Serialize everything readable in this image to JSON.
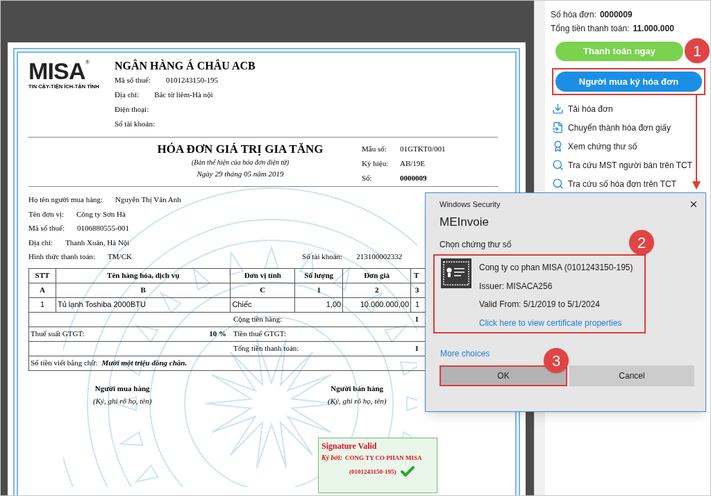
{
  "invoice": {
    "logo": {
      "wordmark": "MISA",
      "registered": "®",
      "tagline": "TIN CẬY-TIỆN ÍCH-TẬN TÌNH"
    },
    "seller": {
      "name": "NGÂN HÀNG Á CHÂU ACB",
      "fields": [
        {
          "label": "Mã số thuế:",
          "value": "0101243150-195"
        },
        {
          "label": "Địa chỉ:",
          "value": "Bắc từ liêm-Hà nội"
        },
        {
          "label": "Điện thoại:"
        },
        {
          "label": "Số tài khoản:"
        }
      ]
    },
    "title": "HÓA ĐƠN GIÁ TRỊ GIA TĂNG",
    "subtitle": "(Bản thể hiện của hóa đơn điện tử)",
    "date": "Ngày 29 tháng 05 năm 2019",
    "meta": [
      {
        "label": "Mẫu số:",
        "value": "01GTKT0/001",
        "bold": false
      },
      {
        "label": "Ký hiệu:",
        "value": "AB/19E",
        "bold": false
      },
      {
        "label": "Số:",
        "value": "0000009",
        "bold": true
      }
    ],
    "buyer": [
      {
        "label": "Họ tên người mua hàng:",
        "value": "Nguyễn Thị Vân Anh"
      },
      {
        "label": "Tên đơn vị:",
        "value": "Công ty Sơn Hà"
      },
      {
        "label": "Mã số thuế:",
        "value": "0106880555-001"
      },
      {
        "label": "Địa chỉ:",
        "value": "Thanh Xuân, Hà Nội"
      },
      {
        "label": "Hình thức thanh toán:",
        "value": "TM/CK"
      }
    ],
    "account": {
      "label": "Số tài khoản:",
      "value": "213100002332"
    },
    "table": {
      "columns": [
        "STT",
        "Tên hàng hóa, dịch vụ",
        "Đơn vị tính",
        "Số lượng",
        "Đơn giá",
        "T"
      ],
      "index_row": [
        "A",
        "B",
        "C",
        "1",
        "2",
        "3"
      ],
      "rows": [
        [
          "1",
          "Tủ lạnh Toshiba 2000BTU",
          "Chiếc",
          "1,00",
          "10.000.000,00",
          "1"
        ]
      ],
      "summary": [
        {
          "kind": "total",
          "label": "Cộng tiền hàng:",
          "value": "1"
        },
        {
          "kind": "tax",
          "rate_label": "Thuế suất GTGT:",
          "rate": "10 %",
          "label": "Tiền thuế GTGT:"
        },
        {
          "kind": "total",
          "label": "Tổng tiền thanh toán:",
          "value": "1"
        }
      ],
      "amount_in_words": {
        "label": "Số tiền viết bằng chữ:",
        "value": "Mười một triệu đồng chẵn."
      }
    },
    "signatures": [
      {
        "title": "Người mua hàng",
        "hint": "(Ký, ghi rõ họ, tên)"
      },
      {
        "title": "Người bán hàng",
        "hint": "(Ký, ghi rõ họ, tên)"
      }
    ],
    "signature_box": {
      "status": "Signature Valid",
      "signed_by_label": "Ký bởi:",
      "signer": "CONG TY CO PHAN MISA",
      "signer_id": "(0101243150-195)"
    }
  },
  "sidebar": {
    "invoice_number": {
      "label": "Số hóa đơn:",
      "value": "0000009"
    },
    "total": {
      "label": "Tổng tiền thanh toán:",
      "value": "11.000.000"
    },
    "pay_button": "Thanh toán ngay",
    "sign_button": "Người mua ký hóa đơn",
    "actions": [
      {
        "kind": "download",
        "label": "Tải hóa đơn"
      },
      {
        "kind": "convert",
        "label": "Chuyển thành hóa đơn giấy"
      },
      {
        "kind": "certificate",
        "label": "Xem chứng thư số"
      },
      {
        "kind": "search",
        "label": "Tra cứu MST người bán trên TCT"
      },
      {
        "kind": "search",
        "label": "Tra cứu số hóa đơn trên TCT"
      }
    ]
  },
  "dialog": {
    "window_title": "Windows Security",
    "app_name": "MEInvoie",
    "prompt": "Chọn chứng thư số",
    "certificate": {
      "name": "Cong ty co phan MISA (0101243150-195)",
      "issuer": "Issuer: MISACA256",
      "validity": "Valid From: 5/1/2019 to 5/1/2024",
      "link": "Click here to view certificate properties"
    },
    "more_choices": "More choices",
    "buttons": [
      {
        "label": "OK",
        "selected": true
      },
      {
        "label": "Cancel",
        "selected": false
      }
    ]
  },
  "callouts": [
    "1",
    "2",
    "3"
  ]
}
